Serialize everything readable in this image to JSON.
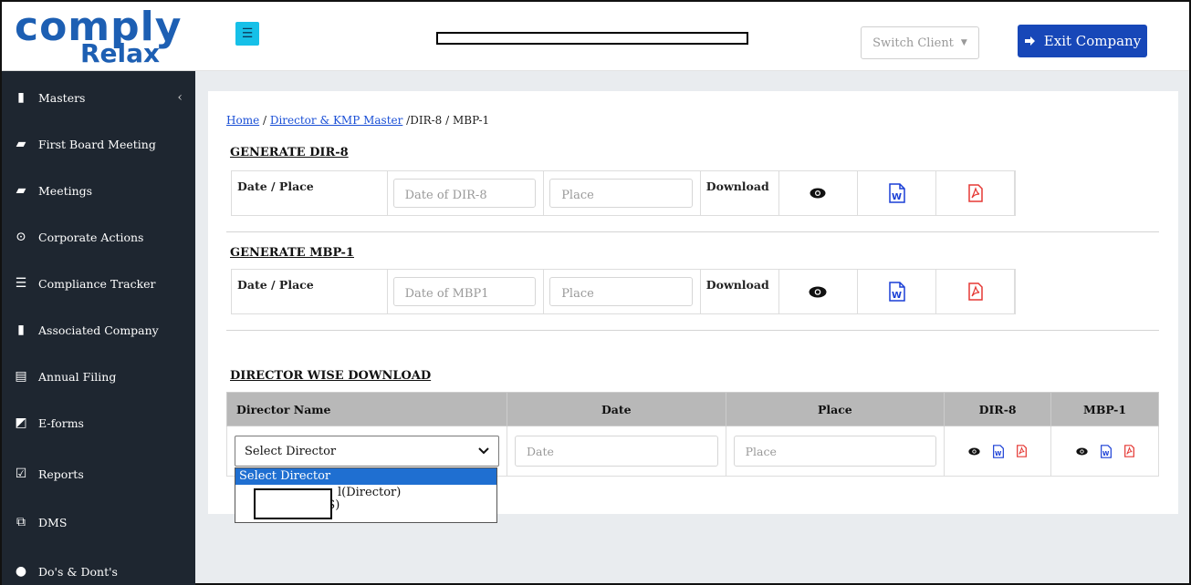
{
  "logo": {
    "line1": "comply",
    "line2": "Relax"
  },
  "sidebar": {
    "items": [
      {
        "label": "Masters",
        "icon": "building-icon"
      },
      {
        "label": "First Board Meeting",
        "icon": "briefcase-icon"
      },
      {
        "label": "Meetings",
        "icon": "briefcase-icon"
      },
      {
        "label": "Corporate Actions",
        "icon": "dot-circle-icon"
      },
      {
        "label": "Compliance Tracker",
        "icon": "list-icon"
      },
      {
        "label": "Associated Company",
        "icon": "building-icon"
      },
      {
        "label": "Annual Filing",
        "icon": "file-icon"
      },
      {
        "label": "E-forms",
        "icon": "edit-box-icon"
      },
      {
        "label": "Reports",
        "icon": "check-square-icon"
      },
      {
        "label": "DMS",
        "icon": "copy-icon"
      },
      {
        "label": "Do's & Dont's",
        "icon": "exclamation-circle-icon"
      }
    ]
  },
  "topbar": {
    "menu_icon": "☰",
    "switch_client": "Switch Client",
    "exit_company": "Exit Company"
  },
  "breadcrumb": {
    "home": "Home",
    "master": "Director & KMP Master",
    "current": " /DIR-8 / MBP-1"
  },
  "dir8": {
    "title": "GENERATE DIR-8",
    "date_place_label": "Date / Place",
    "date_placeholder": "Date of DIR-8",
    "place_placeholder": "Place",
    "download_label": "Download"
  },
  "mbp1": {
    "title": "GENERATE MBP-1",
    "date_place_label": "Date / Place",
    "date_placeholder": "Date of MBP1",
    "place_placeholder": "Place",
    "download_label": "Download"
  },
  "director_wise": {
    "title": "DIRECTOR WISE DOWNLOAD",
    "headers": [
      "Director Name",
      "Date",
      "Place",
      "DIR-8",
      "MBP-1"
    ],
    "select_value": "Select Director",
    "date_placeholder": "Date",
    "place_placeholder": "Place"
  },
  "dropdown": {
    "options": [
      "Select Director",
      "l(Director)",
      "(JS)"
    ]
  },
  "colors": {
    "accent": "#1747b8",
    "sidebar": "#1e2630",
    "word_blue": "#1a3fd6",
    "pdf_red": "#e53935"
  }
}
